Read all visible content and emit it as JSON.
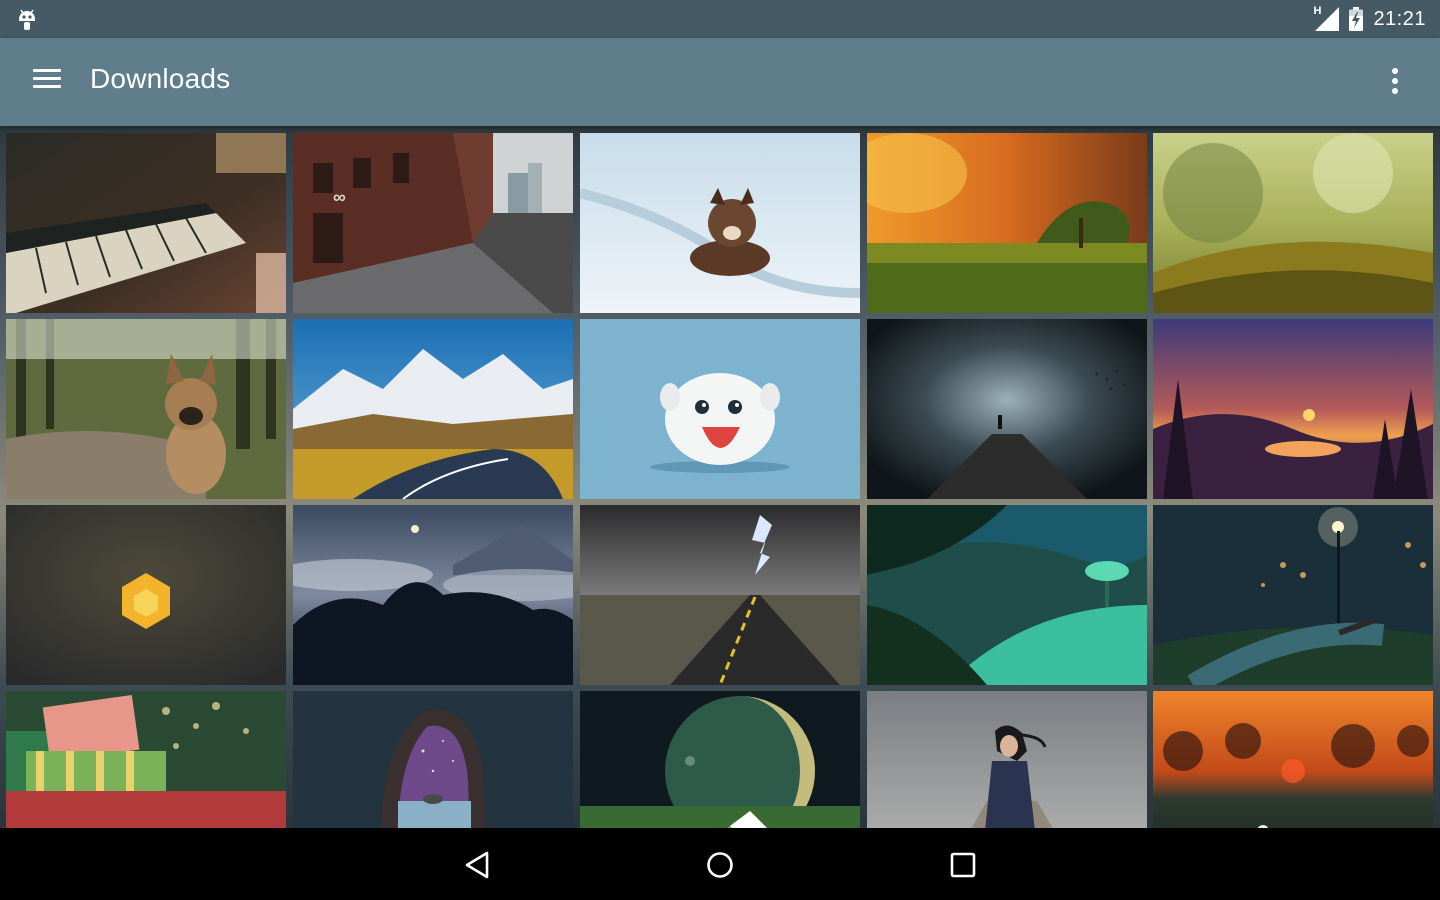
{
  "status_bar": {
    "time": "21:21",
    "network_type": "H",
    "icons": [
      "android-debug-icon",
      "signal-icon",
      "battery-charging-icon"
    ]
  },
  "app_bar": {
    "title": "Downloads",
    "icons": [
      "menu-icon",
      "overflow-menu-icon"
    ]
  },
  "gallery": {
    "tiles": [
      {
        "name": "piano"
      },
      {
        "name": "brick-alley"
      },
      {
        "name": "dog-in-snow"
      },
      {
        "name": "autumn-meadow"
      },
      {
        "name": "mossy-field"
      },
      {
        "name": "french-bulldog"
      },
      {
        "name": "mountain-road"
      },
      {
        "name": "white-fluffy-creature"
      },
      {
        "name": "foggy-pier"
      },
      {
        "name": "sunset-lake-deer"
      },
      {
        "name": "hexagon-logo"
      },
      {
        "name": "night-forest-moon"
      },
      {
        "name": "lightning-road"
      },
      {
        "name": "tree-on-hill"
      },
      {
        "name": "park-bench-night"
      },
      {
        "name": "gift-boxes"
      },
      {
        "name": "cave-sea"
      },
      {
        "name": "planet-mountain"
      },
      {
        "name": "girl-on-pier"
      },
      {
        "name": "dandelions-sunset"
      }
    ]
  },
  "nav_bar": {
    "icons": [
      "back-icon",
      "home-icon",
      "recents-icon"
    ]
  },
  "colors": {
    "status_bar": "#455a64",
    "app_bar": "#5f7d8b",
    "nav_bar": "#000000"
  }
}
